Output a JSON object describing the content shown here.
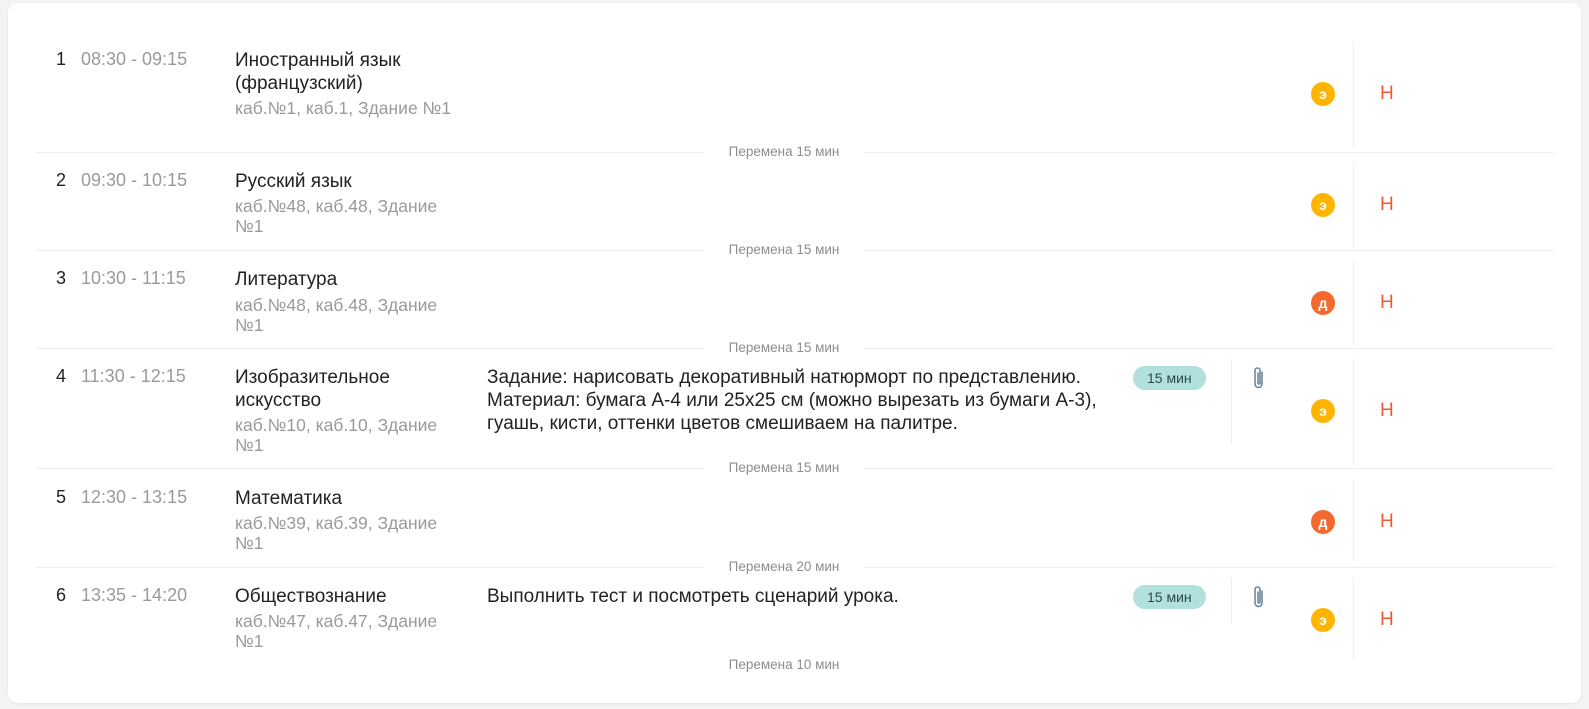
{
  "lessons": [
    {
      "num": "1",
      "time": "08:30 - 09:15",
      "subject": "Иностранный язык (французский)",
      "room": "каб.№1, каб.1, Здание №1",
      "task": "",
      "duration": "",
      "has_attachment": false,
      "badge": "э",
      "badge_type": "e",
      "mark": "Н",
      "break_text": "Перемена 15 мин"
    },
    {
      "num": "2",
      "time": "09:30 - 10:15",
      "subject": "Русский язык",
      "room": "каб.№48, каб.48, Здание №1",
      "task": "",
      "duration": "",
      "has_attachment": false,
      "badge": "э",
      "badge_type": "e",
      "mark": "Н",
      "break_text": "Перемена 15 мин"
    },
    {
      "num": "3",
      "time": "10:30 - 11:15",
      "subject": "Литература",
      "room": "каб.№48, каб.48, Здание №1",
      "task": "",
      "duration": "",
      "has_attachment": false,
      "badge": "д",
      "badge_type": "d",
      "mark": "Н",
      "break_text": "Перемена 15 мин"
    },
    {
      "num": "4",
      "time": "11:30 - 12:15",
      "subject": "Изобразительное искусство",
      "room": "каб.№10, каб.10, Здание №1",
      "task": "Задание: нарисовать декоративный натюрморт по представлению. Материал: бумага А-4 или 25х25 см (можно вырезать из бумаги А-3), гуашь, кисти, оттенки цветов смешиваем на палитре.",
      "duration": "15 мин",
      "has_attachment": true,
      "badge": "э",
      "badge_type": "e",
      "mark": "Н",
      "break_text": "Перемена 15 мин"
    },
    {
      "num": "5",
      "time": "12:30 - 13:15",
      "subject": "Математика",
      "room": "каб.№39, каб.39, Здание №1",
      "task": "",
      "duration": "",
      "has_attachment": false,
      "badge": "д",
      "badge_type": "d",
      "mark": "Н",
      "break_text": "Перемена 20 мин"
    },
    {
      "num": "6",
      "time": "13:35 - 14:20",
      "subject": "Обществознание",
      "room": "каб.№47, каб.47, Здание №1",
      "task": "Выполнить тест и посмотреть сценарий урока.",
      "duration": "15 мин",
      "has_attachment": true,
      "badge": "э",
      "badge_type": "e",
      "mark": "Н",
      "break_text": "Перемена 10 мин"
    }
  ],
  "icons": {
    "attachment": "paperclip-icon"
  },
  "colors": {
    "badge_e": "#ffb400",
    "badge_d": "#f26a2e",
    "mark": "#f05a33",
    "duration_pill": "#b1e0dd"
  }
}
